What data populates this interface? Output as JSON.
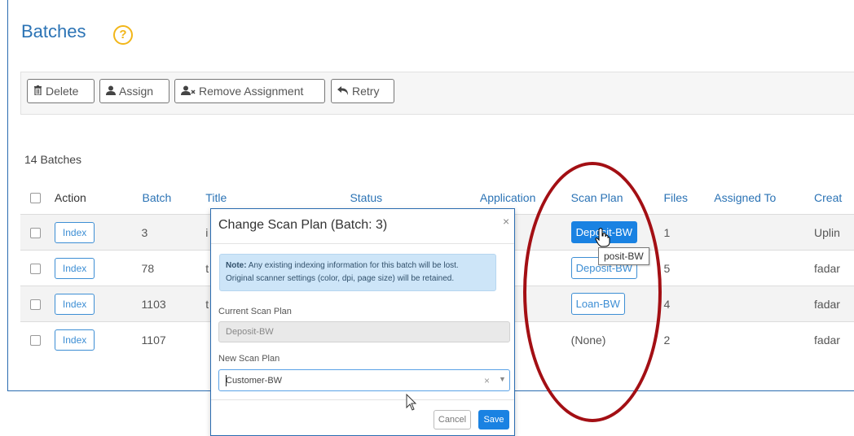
{
  "page": {
    "title": "Batches",
    "help_icon": "question-circle-icon",
    "count_label": "14 Batches"
  },
  "toolbar": {
    "delete_label": "Delete",
    "delete_icon": "trash-icon",
    "assign_label": "Assign",
    "assign_icon": "user-icon",
    "remove_label": "Remove Assignment",
    "remove_icon": "user-remove-icon",
    "retry_label": "Retry",
    "retry_icon": "undo-arrow-icon"
  },
  "table": {
    "columns": [
      "Action",
      "Batch",
      "Title",
      "Status",
      "Application",
      "Scan Plan",
      "Files",
      "Assigned To",
      "Creat"
    ],
    "rows": [
      {
        "action": "Index",
        "batch": "3",
        "title": "i",
        "status": "",
        "application": "",
        "scan_plan": "Deposit-BW",
        "scan_plan_active": true,
        "files": "1",
        "assigned_to": "",
        "created": "Uplin"
      },
      {
        "action": "Index",
        "batch": "78",
        "title": "t",
        "status": "",
        "application": "",
        "scan_plan": "Deposit-BW",
        "scan_plan_active": false,
        "files": "5",
        "assigned_to": "",
        "created": "fadar"
      },
      {
        "action": "Index",
        "batch": "1103",
        "title": "t",
        "status": "",
        "application": "",
        "scan_plan": "Loan-BW",
        "scan_plan_active": false,
        "files": "4",
        "assigned_to": "",
        "created": "fadar"
      },
      {
        "action": "Index",
        "batch": "1107",
        "title": "",
        "status": "",
        "application": "",
        "scan_plan": "(None)",
        "scan_plan_active": false,
        "files": "2",
        "assigned_to": "",
        "created": "fadar"
      }
    ]
  },
  "tooltip": {
    "text": "posit-BW"
  },
  "modal": {
    "title": "Change Scan Plan (Batch: 3)",
    "close": "×",
    "note_bold": "Note:",
    "note_line1": " Any existing indexing information for this batch will be lost.",
    "note_line2": "Original scanner settings (color, dpi, page size) will be retained.",
    "current_label": "Current Scan Plan",
    "current_value": "Deposit-BW",
    "new_label": "New Scan Plan",
    "new_value": "Customer-BW",
    "clear_glyph": "×",
    "dropdown_glyph": "▼",
    "cancel_label": "Cancel",
    "save_label": "Save"
  },
  "colors": {
    "title_blue": "#2b73b5",
    "primary": "#1a82e2",
    "annotation_red": "#a30f14",
    "help_yellow": "#f2b619",
    "note_bg": "#cde5f8"
  }
}
